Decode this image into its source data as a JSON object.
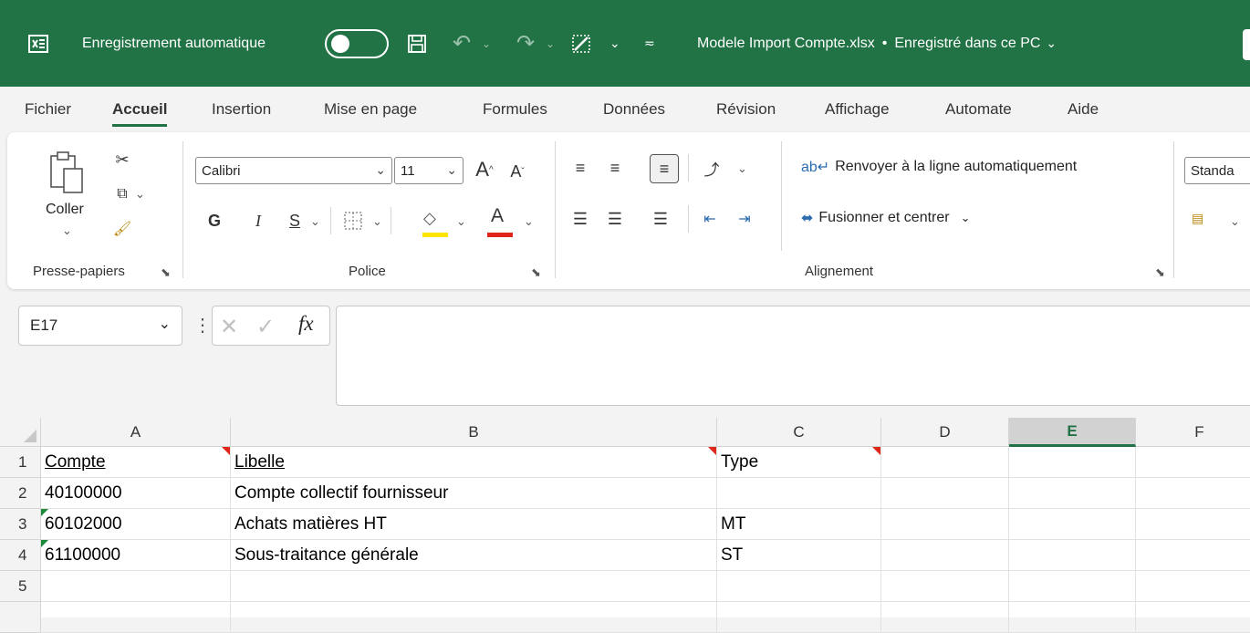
{
  "title_bar": {
    "autosave_label": "Enregistrement automatique",
    "document_title": "Modele Import Compte.xlsx",
    "save_status": "Enregistré dans ce PC",
    "brand_color": "#217346"
  },
  "tabs": [
    "Fichier",
    "Accueil",
    "Insertion",
    "Mise en page",
    "Formules",
    "Données",
    "Révision",
    "Affichage",
    "Automate",
    "Aide"
  ],
  "active_tab": "Accueil",
  "ribbon": {
    "clipboard": {
      "paste_label": "Coller",
      "group_label": "Presse-papiers"
    },
    "font": {
      "font_name": "Calibri",
      "font_size": "11",
      "bold": "G",
      "italic": "I",
      "underline": "S",
      "group_label": "Police"
    },
    "alignment": {
      "wrap_label": "Renvoyer à la ligne automatiquement",
      "merge_label": "Fusionner et centrer",
      "group_label": "Alignement"
    },
    "number": {
      "format_value": "Standa"
    }
  },
  "formula_bar": {
    "name_box": "E17",
    "fx_label": "fx",
    "formula": ""
  },
  "sheet": {
    "columns": [
      "A",
      "B",
      "C",
      "D",
      "E",
      "F"
    ],
    "selected_column": "E",
    "row_numbers": [
      "1",
      "2",
      "3",
      "4",
      "5"
    ],
    "rows": [
      [
        "Compte",
        "Libelle",
        "Type",
        "",
        "",
        ""
      ],
      [
        "40100000",
        "Compte collectif fournisseur",
        "",
        "",
        "",
        ""
      ],
      [
        "60102000",
        "Achats matières HT",
        "MT",
        "",
        "",
        ""
      ],
      [
        "61100000",
        "Sous-traitance générale",
        "ST",
        "",
        "",
        ""
      ],
      [
        "",
        "",
        "",
        "",
        "",
        ""
      ]
    ]
  }
}
